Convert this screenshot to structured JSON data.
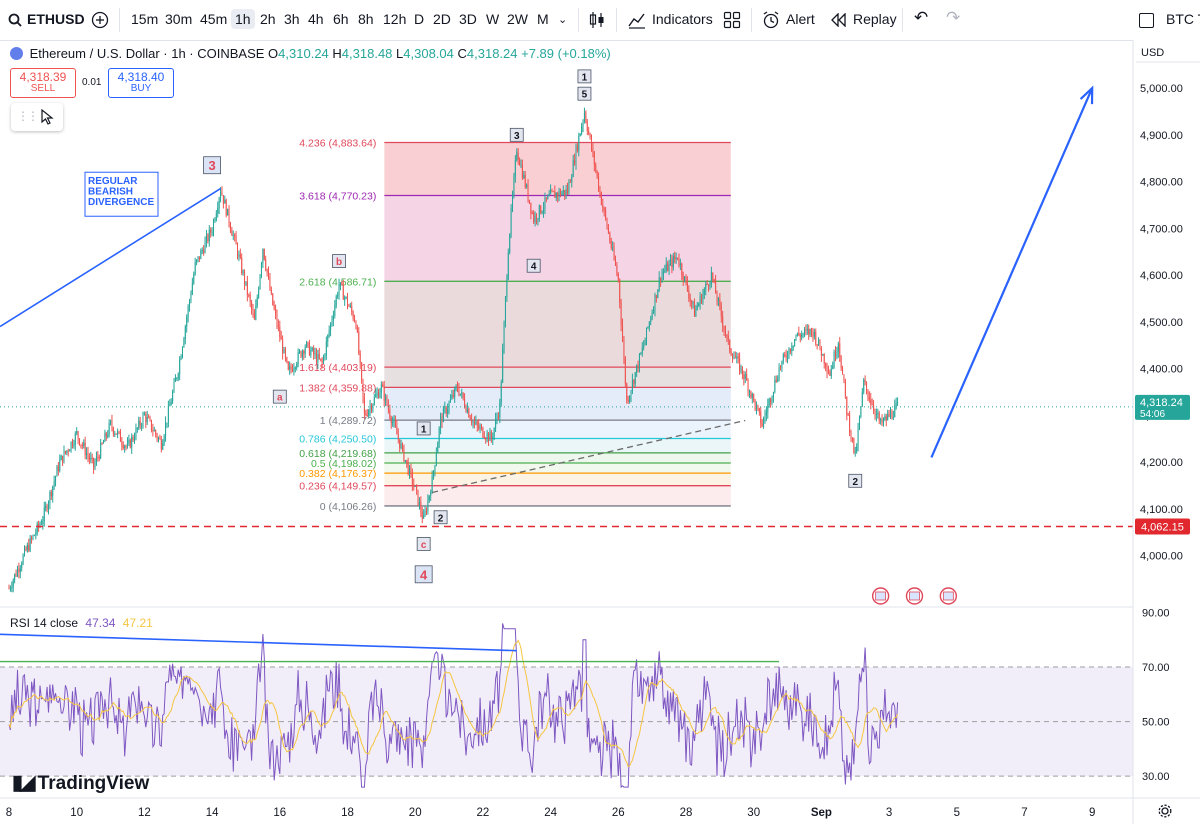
{
  "toolbar": {
    "symbol": "ETHUSD",
    "intervals": [
      "15m",
      "30m",
      "45m",
      "1h",
      "2h",
      "3h",
      "4h",
      "6h",
      "8h",
      "12h",
      "D",
      "2D",
      "3D",
      "W",
      "2W",
      "M"
    ],
    "active_interval": "1h",
    "indicators_label": "Indicators",
    "alert_label": "Alert",
    "replay_label": "Replay",
    "compare_label": "BTC T"
  },
  "header": {
    "title": "Ethereum / U.S. Dollar · 1h · COINBASE",
    "open": "4,310.24",
    "high": "4,318.48",
    "low": "4,308.04",
    "close": "4,318.24",
    "change": "+7.89 (+0.18%)"
  },
  "trade": {
    "sell_price": "4,318.39",
    "sell_label": "SELL",
    "spread": "0.01",
    "buy_price": "4,318.40",
    "buy_label": "BUY"
  },
  "colors": {
    "up": "#26a69a",
    "down": "#ef5350",
    "trend": "#2962ff",
    "rsi": "#7e57c2",
    "rsi_ma": "#f5c542",
    "dash_level": "#e0282e",
    "price_tag": "#26a69a"
  },
  "chart_data": [
    {
      "type": "candlestick",
      "title": "Ethereum / U.S. Dollar · 1h · COINBASE",
      "currency": "USD",
      "ylim": [
        3920,
        5090
      ],
      "y_ticks": [
        "5,000.00",
        "4,900.00",
        "4,800.00",
        "4,700.00",
        "4,600.00",
        "4,500.00",
        "4,400.00",
        "4,300.00",
        "4,200.00",
        "4,100.00",
        "4,000.00"
      ],
      "x_ticks": [
        "8",
        "10",
        "12",
        "14",
        "16",
        "18",
        "20",
        "22",
        "24",
        "26",
        "28",
        "30",
        "Sep",
        "3",
        "5",
        "7",
        "9"
      ],
      "last_price": "4,318.24",
      "countdown": "54:06",
      "key_level": "4,062.15",
      "price_path": [
        {
          "x": "Aug 8 00:00",
          "y": 3930
        },
        {
          "x": "Aug 8 12:00",
          "y": 4010
        },
        {
          "x": "Aug 9 00:00",
          "y": 4080
        },
        {
          "x": "Aug 9 12:00",
          "y": 4200
        },
        {
          "x": "Aug 10 00:00",
          "y": 4260
        },
        {
          "x": "Aug 10 12:00",
          "y": 4190
        },
        {
          "x": "Aug 11 00:00",
          "y": 4280
        },
        {
          "x": "Aug 11 12:00",
          "y": 4230
        },
        {
          "x": "Aug 12 00:00",
          "y": 4300
        },
        {
          "x": "Aug 12 12:00",
          "y": 4240
        },
        {
          "x": "Aug 13 00:00",
          "y": 4400
        },
        {
          "x": "Aug 13 12:00",
          "y": 4620
        },
        {
          "x": "Aug 14 00:00",
          "y": 4700
        },
        {
          "x": "Aug 14 06:00",
          "y": 4785
        },
        {
          "x": "Aug 14 18:00",
          "y": 4650
        },
        {
          "x": "Aug 15 06:00",
          "y": 4500
        },
        {
          "x": "Aug 15 12:00",
          "y": 4660
        },
        {
          "x": "Aug 15 18:00",
          "y": 4550
        },
        {
          "x": "Aug 16 06:00",
          "y": 4390
        },
        {
          "x": "Aug 16 18:00",
          "y": 4450
        },
        {
          "x": "Aug 17 06:00",
          "y": 4410
        },
        {
          "x": "Aug 17 18:00",
          "y": 4580
        },
        {
          "x": "Aug 18 06:00",
          "y": 4500
        },
        {
          "x": "Aug 18 12:00",
          "y": 4300
        },
        {
          "x": "Aug 19 00:00",
          "y": 4360
        },
        {
          "x": "Aug 19 12:00",
          "y": 4250
        },
        {
          "x": "Aug 20 00:00",
          "y": 4140
        },
        {
          "x": "Aug 20 06:00",
          "y": 4075
        },
        {
          "x": "Aug 20 12:00",
          "y": 4160
        },
        {
          "x": "Aug 20 18:00",
          "y": 4290
        },
        {
          "x": "Aug 21 06:00",
          "y": 4360
        },
        {
          "x": "Aug 21 18:00",
          "y": 4280
        },
        {
          "x": "Aug 22 06:00",
          "y": 4250
        },
        {
          "x": "Aug 22 12:00",
          "y": 4320
        },
        {
          "x": "Aug 22 18:00",
          "y": 4660
        },
        {
          "x": "Aug 23 00:00",
          "y": 4870
        },
        {
          "x": "Aug 23 12:00",
          "y": 4720
        },
        {
          "x": "Aug 24 00:00",
          "y": 4770
        },
        {
          "x": "Aug 24 12:00",
          "y": 4780
        },
        {
          "x": "Aug 25 00:00",
          "y": 4950
        },
        {
          "x": "Aug 25 12:00",
          "y": 4760
        },
        {
          "x": "Aug 26 00:00",
          "y": 4590
        },
        {
          "x": "Aug 26 06:00",
          "y": 4330
        },
        {
          "x": "Aug 26 18:00",
          "y": 4450
        },
        {
          "x": "Aug 27 06:00",
          "y": 4600
        },
        {
          "x": "Aug 27 18:00",
          "y": 4640
        },
        {
          "x": "Aug 28 06:00",
          "y": 4520
        },
        {
          "x": "Aug 28 18:00",
          "y": 4600
        },
        {
          "x": "Aug 29 06:00",
          "y": 4450
        },
        {
          "x": "Aug 29 18:00",
          "y": 4380
        },
        {
          "x": "Aug 30 06:00",
          "y": 4280
        },
        {
          "x": "Aug 30 18:00",
          "y": 4400
        },
        {
          "x": "Aug 31 06:00",
          "y": 4470
        },
        {
          "x": "Aug 31 18:00",
          "y": 4480
        },
        {
          "x": "Sep 1 06:00",
          "y": 4390
        },
        {
          "x": "Sep 1 12:00",
          "y": 4460
        },
        {
          "x": "Sep 1 18:00",
          "y": 4310
        },
        {
          "x": "Sep 2 00:00",
          "y": 4210
        },
        {
          "x": "Sep 2 06:00",
          "y": 4370
        },
        {
          "x": "Sep 2 18:00",
          "y": 4280
        },
        {
          "x": "Sep 3 06:00",
          "y": 4318
        }
      ],
      "fib_levels": [
        {
          "ratio": "4.236",
          "price": "4,883.64",
          "value": 4883.64,
          "color": "#e0485b"
        },
        {
          "ratio": "3.618",
          "price": "4,770.23",
          "value": 4770.23,
          "color": "#9c27b0"
        },
        {
          "ratio": "2.618",
          "price": "4,586.71",
          "value": 4586.71,
          "color": "#4caf50"
        },
        {
          "ratio": "1.618",
          "price": "4,403.19",
          "value": 4403.19,
          "color": "#e0485b"
        },
        {
          "ratio": "1.382",
          "price": "4,359.88",
          "value": 4359.88,
          "color": "#e0485b"
        },
        {
          "ratio": "1",
          "price": "4,289.72",
          "value": 4289.72,
          "color": "#787b86"
        },
        {
          "ratio": "0.786",
          "price": "4,250.50",
          "value": 4250.5,
          "color": "#26c6da"
        },
        {
          "ratio": "0.618",
          "price": "4,219.68",
          "value": 4219.68,
          "color": "#43a047"
        },
        {
          "ratio": "0.5",
          "price": "4,198.02",
          "value": 4198.02,
          "color": "#4caf50"
        },
        {
          "ratio": "0.382",
          "price": "4,176.37",
          "value": 4176.37,
          "color": "#ff9800"
        },
        {
          "ratio": "0.236",
          "price": "4,149.57",
          "value": 4149.57,
          "color": "#e0485b"
        },
        {
          "ratio": "0",
          "price": "4,106.26",
          "value": 4106.26,
          "color": "#787b86"
        }
      ],
      "fib_span": {
        "x_start": "Aug 19 00:00",
        "x_end": "Aug 29 12:00"
      },
      "wave_labels": [
        {
          "text": "3",
          "x": "Aug 14 00:00",
          "y": 4835,
          "color": "#e0485b",
          "big": true
        },
        {
          "text": "b",
          "x": "Aug 17 18:00",
          "y": 4630,
          "color": "#e0485b",
          "big": false
        },
        {
          "text": "a",
          "x": "Aug 16 00:00",
          "y": 4340,
          "color": "#e0485b",
          "big": false
        },
        {
          "text": "1",
          "x": "Aug 20 06:00",
          "y": 4272,
          "color": "#131722",
          "big": false
        },
        {
          "text": "2",
          "x": "Aug 20 18:00",
          "y": 4082,
          "color": "#131722",
          "big": false
        },
        {
          "text": "c",
          "x": "Aug 20 06:00",
          "y": 4025,
          "color": "#e0485b",
          "big": false
        },
        {
          "text": "4",
          "x": "Aug 20 06:00",
          "y": 3960,
          "color": "#e0485b",
          "big": true
        },
        {
          "text": "3",
          "x": "Aug 23 00:00",
          "y": 4900,
          "color": "#131722",
          "big": false
        },
        {
          "text": "4",
          "x": "Aug 23 12:00",
          "y": 4620,
          "color": "#131722",
          "big": false
        },
        {
          "text": "1",
          "x": "Aug 25 00:00",
          "y": 5025,
          "color": "#131722",
          "big": false
        },
        {
          "text": "5",
          "x": "Aug 25 00:00",
          "y": 4988,
          "color": "#131722",
          "big": false
        },
        {
          "text": "2",
          "x": "Sep 2 00:00",
          "y": 4160,
          "color": "#131722",
          "big": false
        }
      ],
      "annotation": "REGULAR\nBEARISH\nDIVERGENCE"
    },
    {
      "type": "line",
      "title": "RSI 14 close",
      "rsi_value": "47.34",
      "ma_value": "47.21",
      "ylim": [
        22,
        92
      ],
      "y_ticks": [
        "90.00",
        "70.00",
        "50.00",
        "30.00"
      ],
      "bands": [
        70,
        50,
        30
      ]
    }
  ],
  "brand": "TradingView"
}
